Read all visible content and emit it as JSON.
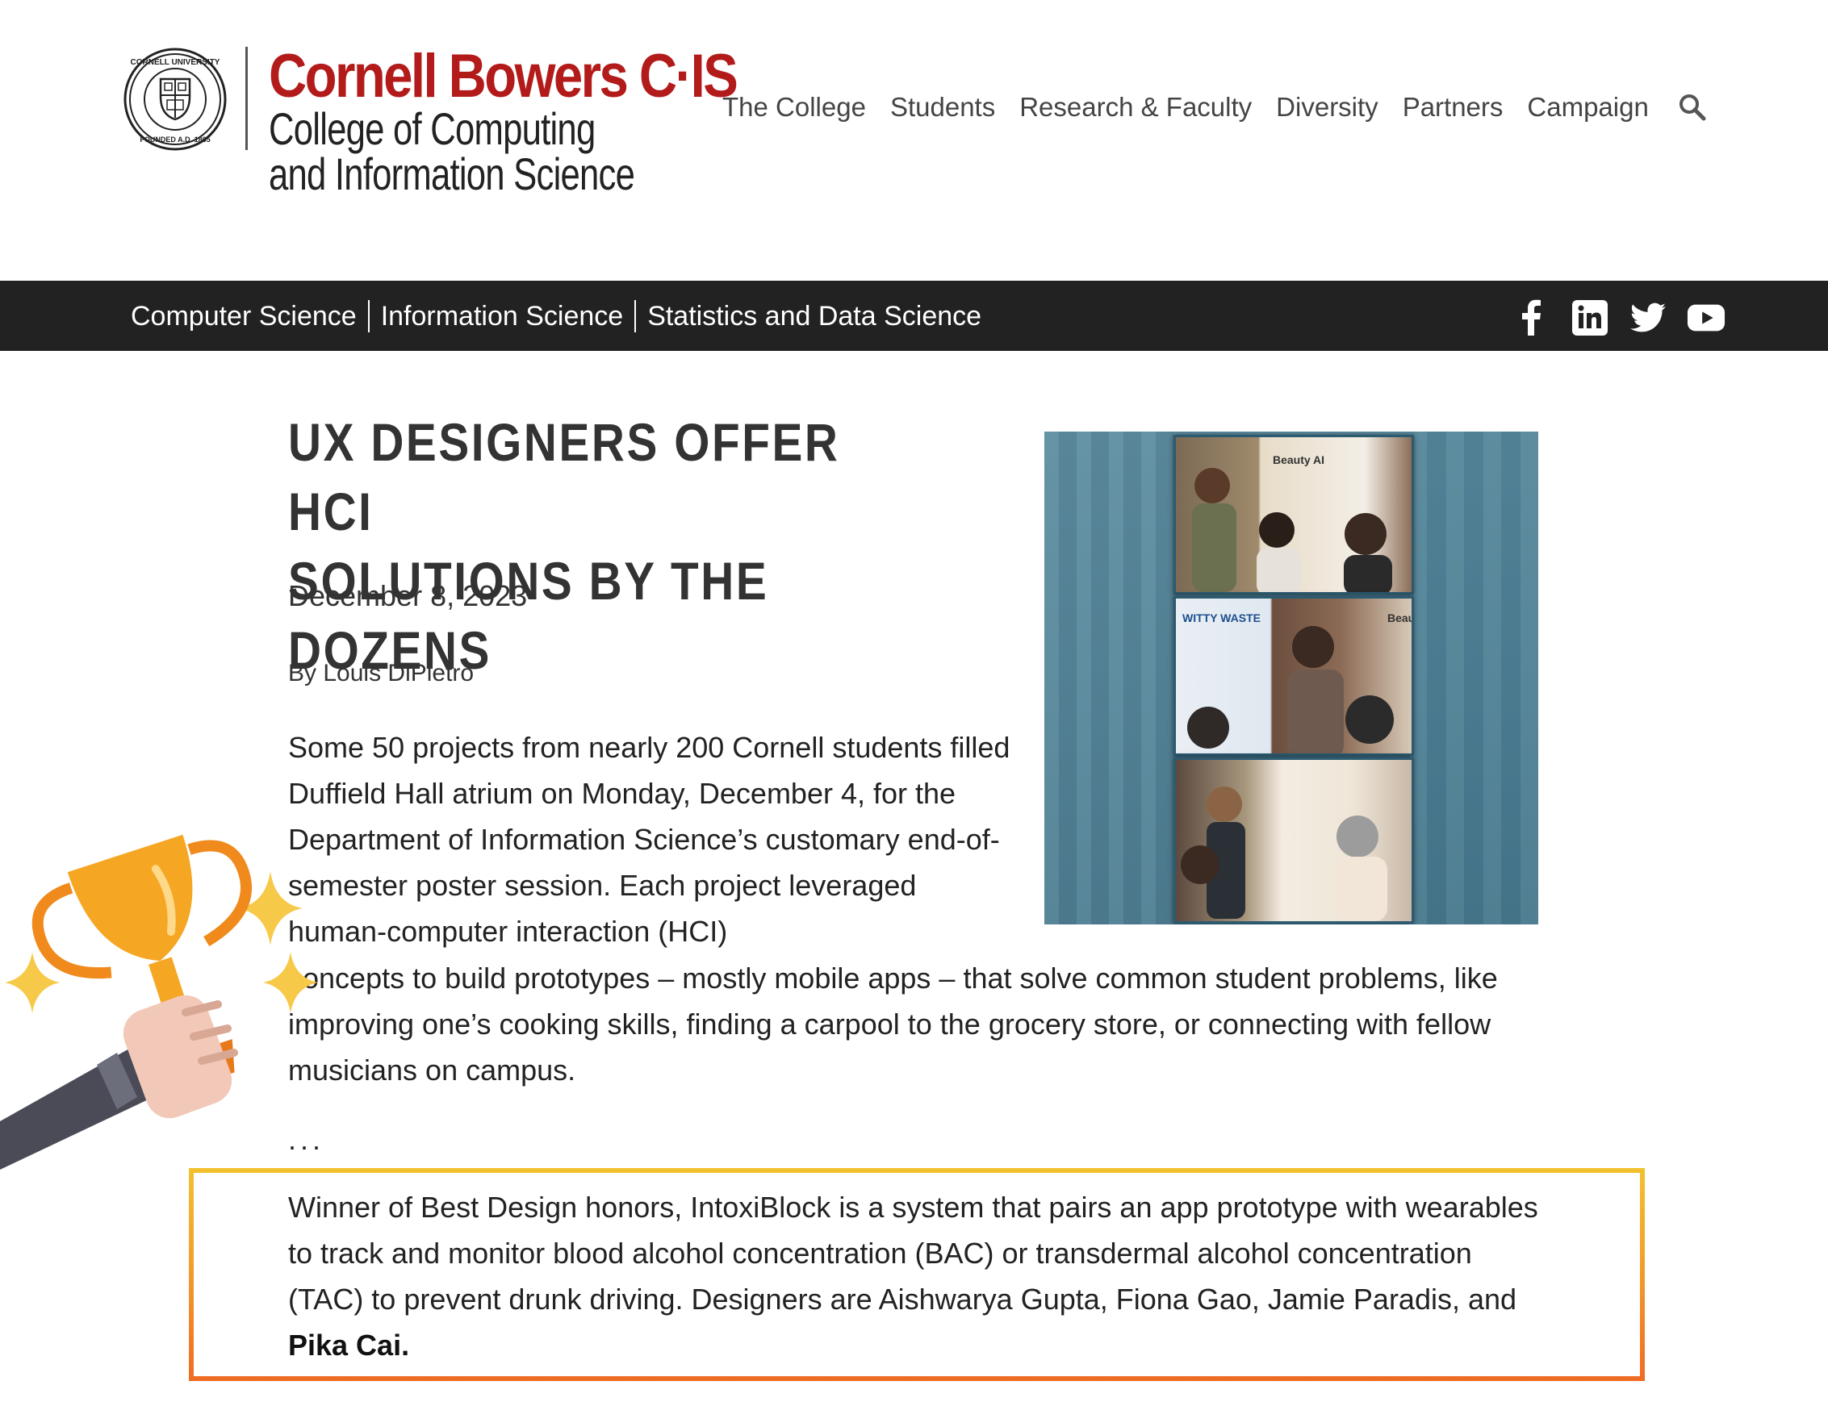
{
  "header": {
    "seal_text_top": "CORNELL UNIVERSITY",
    "seal_text_bottom": "FOUNDED A.D. 1865",
    "brand": "Cornell Bowers C·IS",
    "subtitle_line1": "College of Computing",
    "subtitle_line2": "and Information Science",
    "nav": [
      "The College",
      "Students",
      "Research & Faculty",
      "Diversity",
      "Partners",
      "Campaign"
    ],
    "search_icon": "search-icon"
  },
  "program_bar": {
    "links": [
      "Computer Science",
      "Information Science",
      "Statistics and Data Science"
    ],
    "social_icons": [
      "facebook-icon",
      "linkedin-icon",
      "twitter-icon",
      "youtube-icon"
    ]
  },
  "article": {
    "title_line1": "UX DESIGNERS OFFER HCI",
    "title_line2": "SOLUTIONS BY THE DOZENS",
    "date": "December 8, 2023",
    "byline": "By Louis DiPietro",
    "para1_narrow": "Some 50 projects from nearly 200 Cornell students filled Duffield Hall atrium on Monday, December 4, for the Department of Information Science’s customary end-of-semester poster session. Each project leveraged human-computer interaction (HCI)",
    "para1_wide": "concepts to build prototypes – mostly mobile apps – that solve common student problems, like improving one’s cooking skills, finding a carpool to the grocery store, or connecting with fellow musicians on campus.",
    "ellipsis": "...",
    "winner_text": "Winner of Best Design honors, IntoxiBlock is a system that pairs an app prototype with wearables to track and monitor blood alcohol concentration (BAC) or transdermal alcohol concentration (TAC) to prevent drunk driving. Designers are Aishwarya Gupta, Fiona Gao, Jamie Paradis, and",
    "winner_bold": "Pika Cai."
  },
  "photo": {
    "poster1_label": "Beauty AI",
    "poster2_label": "WITTY WASTE",
    "poster2_side_label": "Beaut"
  },
  "colors": {
    "brand_red": "#b31b1b",
    "dark_bar": "#222222",
    "highlight_top": "#f2c12e",
    "highlight_bottom": "#ef6b24",
    "trophy_gold": "#f5a623"
  }
}
